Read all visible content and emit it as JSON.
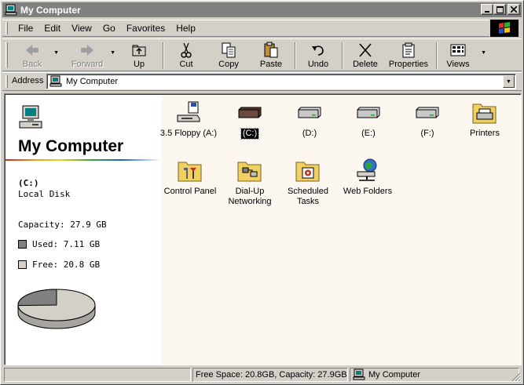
{
  "window": {
    "title": "My Computer"
  },
  "menu": [
    "File",
    "Edit",
    "View",
    "Go",
    "Favorites",
    "Help"
  ],
  "toolbar": {
    "back": "Back",
    "forward": "Forward",
    "up": "Up",
    "cut": "Cut",
    "copy": "Copy",
    "paste": "Paste",
    "undo": "Undo",
    "delete": "Delete",
    "properties": "Properties",
    "views": "Views"
  },
  "address": {
    "label": "Address",
    "value": "My Computer"
  },
  "left_pane": {
    "title": "My Computer",
    "drive": "(C:)",
    "drive_type": "Local Disk",
    "capacity": "Capacity: 27.9 GB",
    "used": "Used: 7.11 GB",
    "free": "Free: 20.8 GB",
    "used_fraction": 0.255,
    "colors": {
      "used": "#808080",
      "free": "#d4d0c8"
    }
  },
  "icons": [
    {
      "label": "3.5 Floppy (A:)",
      "icon": "floppy-drive-icon",
      "selected": false
    },
    {
      "label": "(C:)",
      "icon": "hard-drive-icon",
      "selected": true
    },
    {
      "label": "(D:)",
      "icon": "hard-drive-icon",
      "selected": false
    },
    {
      "label": "(E:)",
      "icon": "hard-drive-icon",
      "selected": false
    },
    {
      "label": "(F:)",
      "icon": "hard-drive-icon",
      "selected": false
    },
    {
      "label": "Printers",
      "icon": "printers-folder-icon",
      "selected": false
    },
    {
      "label": "Control Panel",
      "icon": "control-panel-folder-icon",
      "selected": false
    },
    {
      "label": "Dial-Up\nNetworking",
      "icon": "dialup-networking-folder-icon",
      "selected": false
    },
    {
      "label": "Scheduled\nTasks",
      "icon": "scheduled-tasks-folder-icon",
      "selected": false
    },
    {
      "label": "Web Folders",
      "icon": "web-folders-icon",
      "selected": false
    }
  ],
  "status": {
    "space": "Free Space: 20.8GB,  Capacity: 27.9GB",
    "location": "My Computer"
  },
  "colors": {
    "titlebar": "#808080",
    "face": "#d4d0c8",
    "content_right": "#fcf8f0"
  }
}
